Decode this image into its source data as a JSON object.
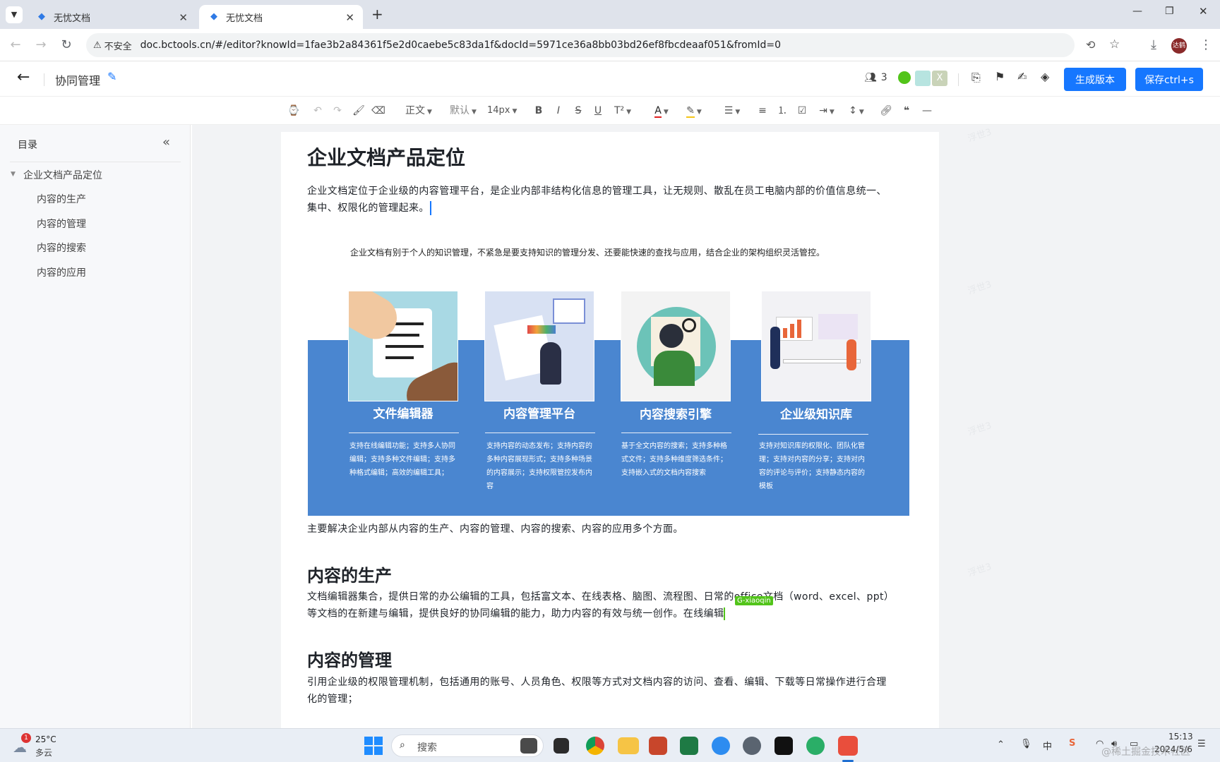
{
  "browser": {
    "tabs": [
      {
        "title": "无忧文档",
        "active": false
      },
      {
        "title": "无忧文档",
        "active": true
      }
    ],
    "new_tab": "+",
    "insecure_label": "不安全",
    "url": "doc.bctools.cn/#/editor?knowId=1fae3b2a84361f5e2d0caebe5c83da1f&docId=5971ce36a8bb03bd26ef8fbcdeaaf051&fromId=0",
    "avatar_text": "达鹤"
  },
  "header": {
    "back": "←",
    "doc_title": "协同管理",
    "collaborator_count": "3",
    "avatar_x": "X",
    "generate_version": "生成版本",
    "save": "保存ctrl+s"
  },
  "toolbar": {
    "paragraph_style": "正文",
    "font_family": "默认",
    "font_size": "14px"
  },
  "sidebar": {
    "title": "目录",
    "collapse": "«",
    "items": [
      {
        "label": "企业文档产品定位",
        "level": 1
      },
      {
        "label": "内容的生产",
        "level": 2
      },
      {
        "label": "内容的管理",
        "level": 2
      },
      {
        "label": "内容的搜索",
        "level": 2
      },
      {
        "label": "内容的应用",
        "level": 2
      }
    ]
  },
  "document": {
    "h1": "企业文档产品定位",
    "intro_line1": "企业文档定位于企业级的内容管理平台，是企业内部非结构化信息的管理工具，让无规则、散乱在员工电脑内部的价值信息统一、",
    "intro_line2": "集中、权限化的管理起来。",
    "figure_caption": "企业文档有别于个人的知识管理，不紧急是要支持知识的管理分发、还要能快速的查找与应用，结合企业的架构组织灵活管控。",
    "cards": [
      {
        "title": "文件编辑器",
        "desc": "支持在线编辑功能；支持多人协同编辑；支持多种文件编辑；支持多种格式编辑；高效的编辑工具；"
      },
      {
        "title": "内容管理平台",
        "desc": "支持内容的动态发布；支持内容的多种内容展现形式；支持多种场景的内容展示；支持权限管控发布内容"
      },
      {
        "title": "内容搜索引擎",
        "desc": "基于全文内容的搜索；支持多种格式文件；支持多种维度筛选条件；支持嵌入式的文档内容搜索"
      },
      {
        "title": "企业级知识库",
        "desc": "支持对知识库的权限化、团队化管理；支持对内容的分享；支持对内容的评论与评价；支持静态内容的模板"
      }
    ],
    "summary": "主要解决企业内部从内容的生产、内容的管理、内容的搜索、内容的应用多个方面。",
    "h2_production": "内容的生产",
    "production_line1": "文档编辑器集合，提供日常的办公编辑的工具，包括富文本、在线表格、脑图、流程图、日常的office文档（word、excel、ppt）",
    "production_line2": "等文档的在新建与编辑，提供良好的协同编辑的能力，助力内容的有效与统一创作。在线编辑",
    "collab_cursor_label": "G-xiaoqin",
    "h2_management": "内容的管理",
    "management_line1": "引用企业级的权限管理机制，包括通用的账号、人员角色、权限等方式对文档内容的访问、查看、编辑、下载等日常操作进行合理",
    "management_line2": "化的管理；",
    "watermark": "浮世3"
  },
  "taskbar": {
    "weather_temp": "25°C",
    "weather_desc": "多云",
    "weather_badge": "1",
    "search_placeholder": "搜索",
    "ime": "中",
    "time": "15:13",
    "date": "2024/5/6",
    "credit": "@稀土掘金技术社区"
  },
  "colors": {
    "accent": "#1677ff",
    "infographic_bg": "#4a86d0",
    "collab_cursor": "#52c41a"
  }
}
